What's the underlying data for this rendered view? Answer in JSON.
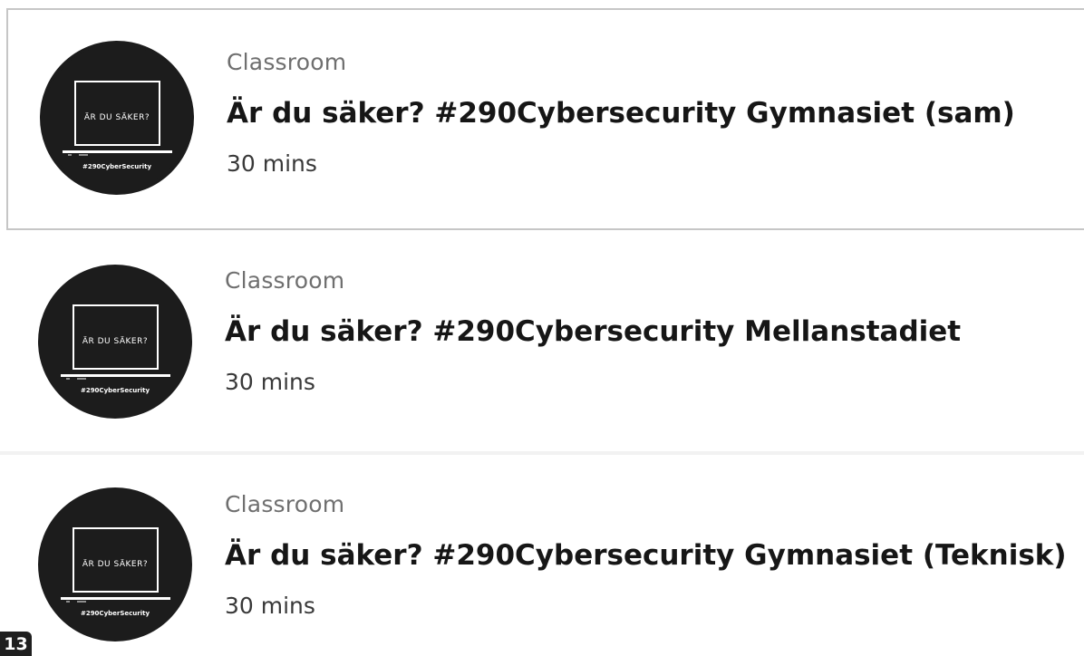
{
  "courses": [
    {
      "category": "Classroom",
      "title": "Är du säker? #290Cybersecurity Gymnasiet (sam)",
      "duration": "30 mins",
      "thumb_screen_text": "ÄR DU SÄKER?",
      "thumb_tag": "#290CyberSecurity",
      "selected": true
    },
    {
      "category": "Classroom",
      "title": "Är du säker? #290Cybersecurity Mellanstadiet",
      "duration": "30 mins",
      "thumb_screen_text": "ÄR DU SÄKER?",
      "thumb_tag": "#290CyberSecurity",
      "selected": false
    },
    {
      "category": "Classroom",
      "title": "Är du säker? #290Cybersecurity Gymnasiet (Teknisk)",
      "duration": "30 mins",
      "thumb_screen_text": "ÄR DU SÄKER?",
      "thumb_tag": "#290CyberSecurity",
      "selected": false
    }
  ],
  "page_badge": "13",
  "colors": {
    "thumb_bg": "#1c1c1c",
    "thumb_line": "#ffffff",
    "selected_border": "#c6c6c6",
    "text_primary": "#161616",
    "text_secondary": "#6f6f6f"
  }
}
